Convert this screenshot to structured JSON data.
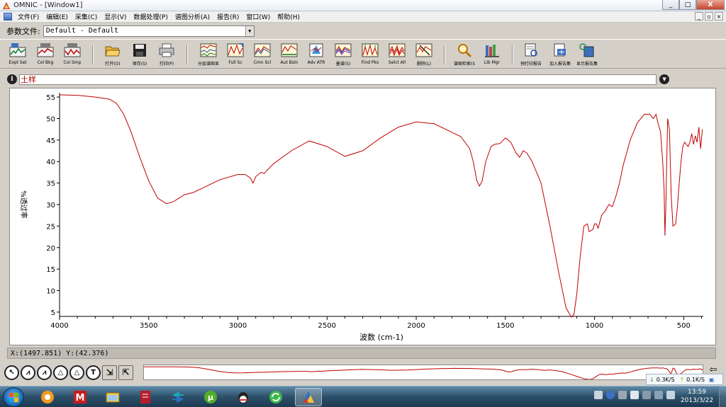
{
  "window": {
    "title": "OMNIC - [Window1]",
    "minimize": "_",
    "maximize": "□",
    "close": "X"
  },
  "menu": [
    "文件(F)",
    "编辑(E)",
    "采集(C)",
    "显示(V)",
    "数据处理(P)",
    "谱图分析(A)",
    "报告(R)",
    "窗口(W)",
    "帮助(H)"
  ],
  "mdi_buttons": {
    "minimize": "_",
    "restore": "▫",
    "close": "×"
  },
  "experiment": {
    "label": "参数文件:",
    "value": "Default - Default"
  },
  "toolbar": [
    {
      "label": "Expt Set",
      "icon": "expt-set-icon"
    },
    {
      "label": "Col Bkg",
      "icon": "col-bkg-icon"
    },
    {
      "label": "Col Smp",
      "icon": "col-smp-icon"
    },
    {
      "label": "打开(O)",
      "icon": "open-folder-icon"
    },
    {
      "label": "保存(S)",
      "icon": "save-disk-icon"
    },
    {
      "label": "打印(P)",
      "icon": "printer-icon"
    },
    {
      "label": "分层谱图显",
      "icon": "stack-spectra-icon"
    },
    {
      "label": "Full Sc",
      "icon": "full-scale-icon"
    },
    {
      "label": "Cmn Scl",
      "icon": "common-scale-icon"
    },
    {
      "label": "Aut Bsln",
      "icon": "auto-baseline-icon"
    },
    {
      "label": "Adv ATR",
      "icon": "adv-atr-icon"
    },
    {
      "label": "叠谱(S)",
      "icon": "overlay-icon"
    },
    {
      "label": "Find Pks",
      "icon": "find-peaks-icon"
    },
    {
      "label": "Selct All",
      "icon": "select-all-icon"
    },
    {
      "label": "删除(L)",
      "icon": "delete-spectrum-icon"
    },
    {
      "label": "谱图检索(S",
      "icon": "search-magnifier-icon"
    },
    {
      "label": "Lib Mgr",
      "icon": "library-manager-icon"
    },
    {
      "label": "预打印报告",
      "icon": "preview-report-icon"
    },
    {
      "label": "加入报告集",
      "icon": "add-report-icon"
    },
    {
      "label": "显示报告集",
      "icon": "show-report-icon"
    }
  ],
  "spectrum": {
    "title": "土样",
    "info_icon": "i",
    "dropdown_icon": "▼"
  },
  "status": {
    "cursor": "X:(1497.851) Y:(42.376)"
  },
  "overview_arrow": "⇦",
  "tray_popup": {
    "down": "0.3K/S",
    "up": "0.1K/S"
  },
  "clock": {
    "time": "13:59",
    "date": "2013/3/22"
  },
  "colors": {
    "trace": "#c00000",
    "title_text": "#b00000",
    "plot_bg": "#ffffff"
  },
  "chart_data": {
    "type": "line",
    "xlabel": "波数 (cm-1)",
    "ylabel": "%透过率",
    "xlim": [
      4000,
      390
    ],
    "ylim": [
      4,
      56
    ],
    "x_ticks": [
      4000,
      3500,
      3000,
      2500,
      2000,
      1500,
      1000,
      500
    ],
    "y_ticks": [
      5,
      10,
      15,
      20,
      25,
      30,
      35,
      40,
      45,
      50,
      55
    ],
    "grid": false,
    "series": [
      {
        "x": [
          4000,
          3900,
          3800,
          3720,
          3680,
          3640,
          3600,
          3550,
          3500,
          3450,
          3400,
          3360,
          3300,
          3250,
          3200,
          3100,
          3000,
          2960,
          2930,
          2915,
          2900,
          2870,
          2852,
          2840,
          2800,
          2700,
          2600,
          2500,
          2400,
          2300,
          2200,
          2100,
          2000,
          1900,
          1800,
          1750,
          1700,
          1680,
          1660,
          1645,
          1630,
          1610,
          1580,
          1560,
          1530,
          1500,
          1470,
          1440,
          1420,
          1400,
          1380,
          1350,
          1300,
          1250,
          1200,
          1160,
          1130,
          1115,
          1100,
          1080,
          1060,
          1040,
          1030,
          1010,
          1000,
          990,
          980,
          960,
          940,
          920,
          900,
          880,
          860,
          840,
          800,
          760,
          720,
          690,
          670,
          655,
          645,
          630,
          618,
          610,
          605,
          600,
          595,
          590,
          580,
          570,
          560,
          545,
          535,
          525,
          515,
          505,
          495,
          485,
          475,
          465,
          455,
          445,
          435,
          425,
          415,
          405,
          395
        ],
        "y": [
          55.5,
          55.4,
          55,
          54.5,
          53.5,
          51,
          47,
          41,
          35.5,
          31.5,
          30.2,
          30.7,
          32.3,
          32.8,
          33.8,
          35.8,
          37,
          37,
          36.2,
          35,
          36.5,
          37.5,
          37.2,
          37.8,
          39.5,
          42.5,
          44.8,
          43.5,
          41.2,
          42.5,
          45.5,
          48,
          49.2,
          48.8,
          46.8,
          45.8,
          43,
          40,
          35.5,
          34.3,
          35.5,
          40,
          43.5,
          44,
          44.2,
          45.5,
          44.5,
          42,
          41,
          42.5,
          42,
          40,
          35,
          25,
          14,
          6,
          3.8,
          4.5,
          9,
          18,
          25,
          25.5,
          23.7,
          24.2,
          25.5,
          25.5,
          24.5,
          27.5,
          28.5,
          30,
          29.5,
          32,
          35,
          39,
          45,
          49,
          51,
          51,
          50,
          51,
          49,
          47,
          40,
          33.5,
          22.8,
          30,
          40,
          50,
          47.5,
          32,
          25,
          25.5,
          29.5,
          35,
          40,
          43.5,
          44.5,
          44,
          43.5,
          44.5,
          46.5,
          44,
          46,
          44.5,
          48,
          43,
          47.5
        ]
      }
    ]
  }
}
